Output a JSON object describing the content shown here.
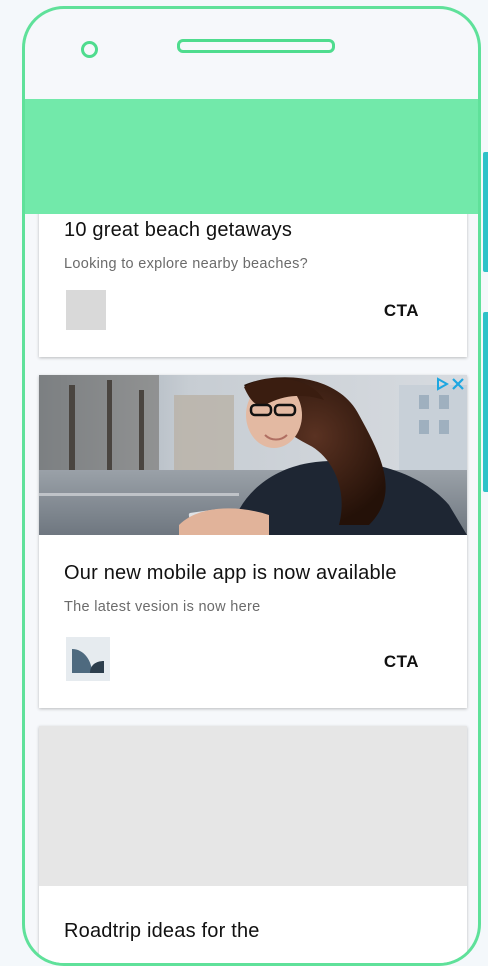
{
  "cards": [
    {
      "title": "10 great beach getaways",
      "subtitle": "Looking to explore nearby beaches?",
      "cta": "CTA",
      "thumb_icon": "placeholder-icon"
    },
    {
      "title": "Our new mobile app is now available",
      "subtitle": "The latest vesion is now here",
      "cta": "CTA",
      "image": "woman-looking-at-phone-photo",
      "thumb_icon": "brand-logo-icon",
      "adchoices_icon": "adchoices-icon",
      "close_icon": "close-icon"
    },
    {
      "title": "Roadtrip ideas for the",
      "image": "image-placeholder"
    }
  ],
  "colors": {
    "phone_outline": "#5fe19a",
    "header_bar": "#72e9aa",
    "side_buttons": "#2ec2c8",
    "adchoices": "#1ea7e1"
  }
}
